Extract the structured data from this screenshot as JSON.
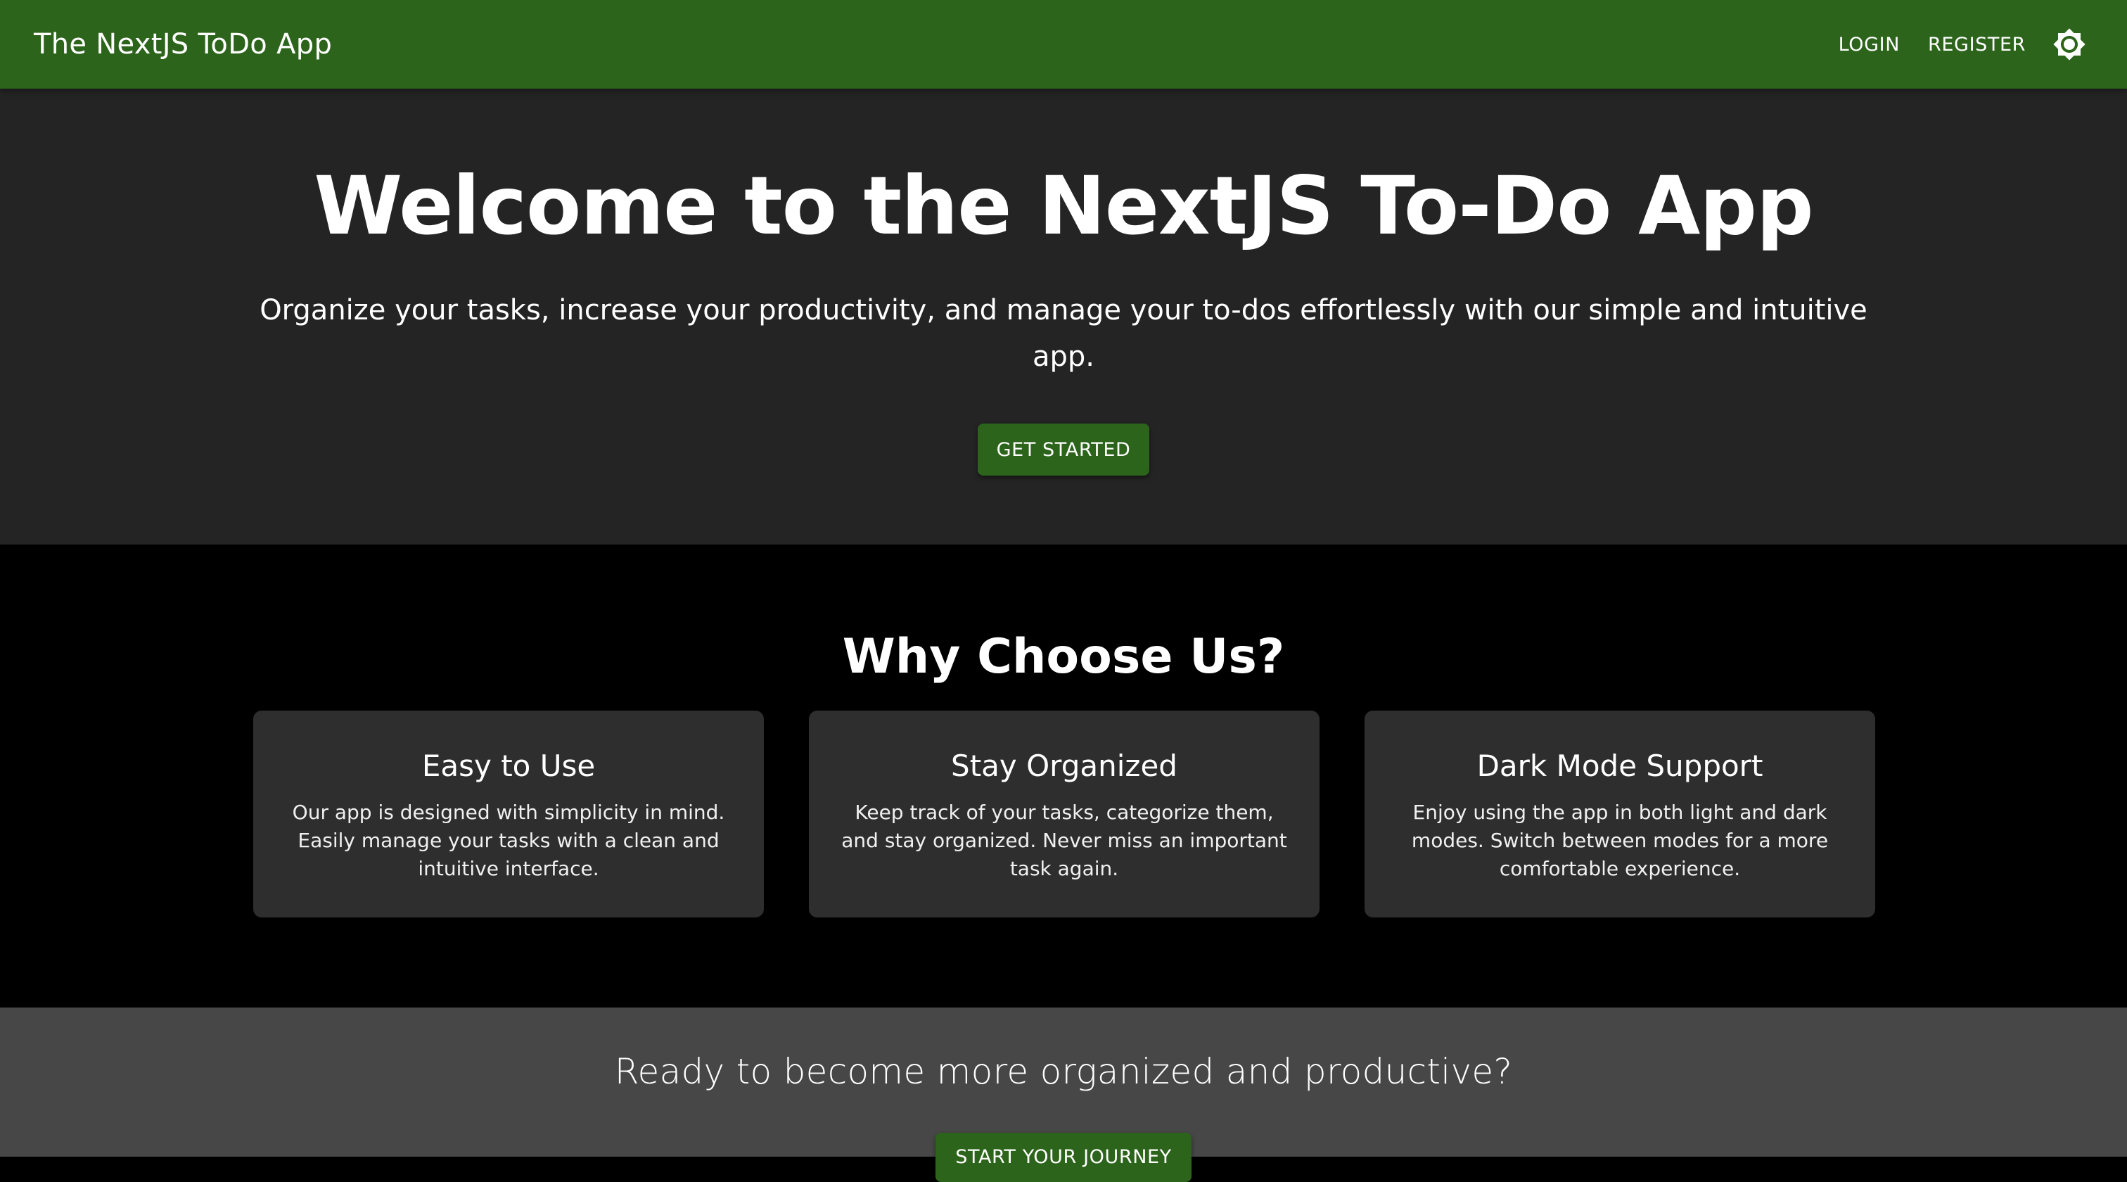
{
  "appbar": {
    "title": "The NextJS ToDo App",
    "login_label": "LOGIN",
    "register_label": "REGISTER",
    "theme_icon": "brightness-icon"
  },
  "hero": {
    "heading": "Welcome to the NextJS To-Do App",
    "subheading": "Organize your tasks, increase your productivity, and manage your to-dos effortlessly with our simple and intuitive app.",
    "cta_label": "GET STARTED"
  },
  "features": {
    "heading": "Why Choose Us?",
    "cards": [
      {
        "title": "Easy to Use",
        "text": "Our app is designed with simplicity in mind. Easily manage your tasks with a clean and intuitive interface."
      },
      {
        "title": "Stay Organized",
        "text": "Keep track of your tasks, categorize them, and stay organized. Never miss an important task again."
      },
      {
        "title": "Dark Mode Support",
        "text": "Enjoy using the app in both light and dark modes. Switch between modes for a more comfortable experience."
      }
    ]
  },
  "cta": {
    "heading": "Ready to become more organized and productive?",
    "button_label": "START YOUR JOURNEY"
  },
  "colors": {
    "primary": "#2c641b",
    "hero_bg": "#242424",
    "features_bg": "#000000",
    "card_bg": "#2e2e2e",
    "cta_bg": "#474747"
  }
}
